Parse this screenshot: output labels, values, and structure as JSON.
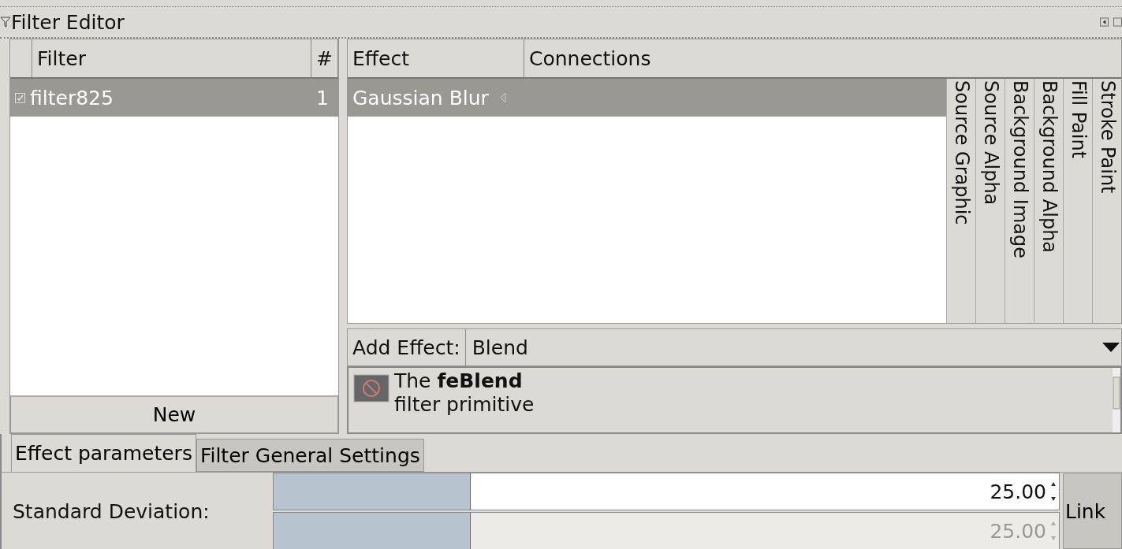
{
  "panel": {
    "title": "Filter Editor"
  },
  "filters": {
    "columns": [
      "Filter",
      "#"
    ],
    "rows": [
      {
        "name": "filter825",
        "count": "1",
        "checked": true,
        "selected": true
      }
    ],
    "new_button": "New"
  },
  "effects": {
    "columns": [
      "Effect",
      "Connections"
    ],
    "rows": [
      {
        "name": "Gaussian Blur",
        "selected": true
      }
    ],
    "inputs": [
      "Source Graphic",
      "Source Alpha",
      "Background Image",
      "Background Alpha",
      "Fill Paint",
      "Stroke Paint"
    ]
  },
  "add_effect": {
    "label": "Add Effect:",
    "value": "Blend"
  },
  "description": "The **feBlend**\nfilter primitive",
  "tabs": [
    {
      "label": "Effect parameters",
      "selected": true
    },
    {
      "label": "Filter General Settings",
      "selected": false
    }
  ],
  "params": [
    {
      "label": "Standard Deviation:",
      "link_button": "Link",
      "sliders": [
        {
          "value": "25.00",
          "level": 0.25,
          "disabled": false
        },
        {
          "value": "25.00",
          "level": 0.25,
          "disabled": true
        }
      ]
    }
  ]
}
